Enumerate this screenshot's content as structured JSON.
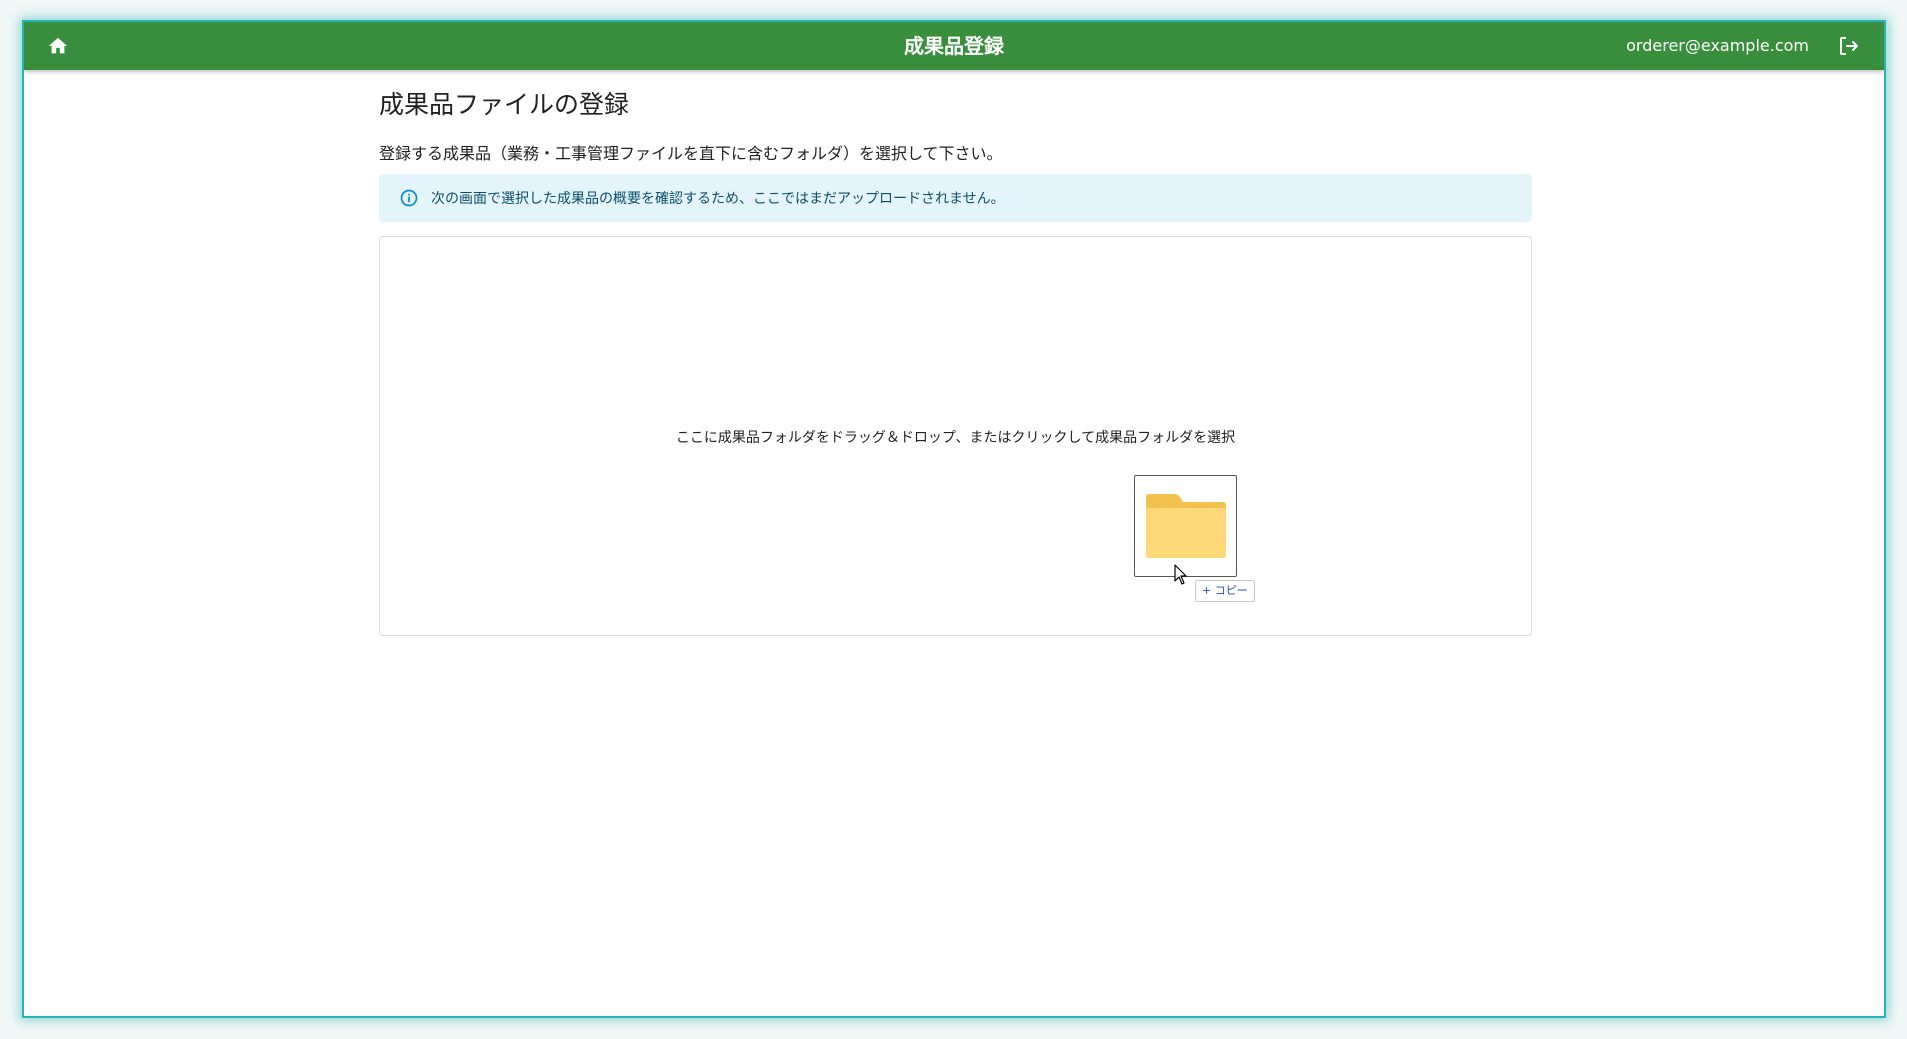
{
  "appbar": {
    "title": "成果品登録",
    "user_email": "orderer@example.com",
    "color": "#388e3c",
    "home_icon": "home-icon",
    "logout_icon": "logout-icon"
  },
  "page": {
    "title": "成果品ファイルの登録",
    "subtitle": "登録する成果品（業務・工事管理ファイルを直下に含むフォルダ）を選択して下さい。"
  },
  "info_alert": {
    "icon": "info-icon",
    "text": "次の画面で選択した成果品の概要を確認するため、ここではまだアップロードされません。",
    "background": "#e3f4fa"
  },
  "dropzone": {
    "instruction": "ここに成果品フォルダをドラッグ＆ドロップ、またはクリックして成果品フォルダを選択",
    "drag_preview_icon": "folder-icon",
    "copy_badge": "+ コピー"
  }
}
